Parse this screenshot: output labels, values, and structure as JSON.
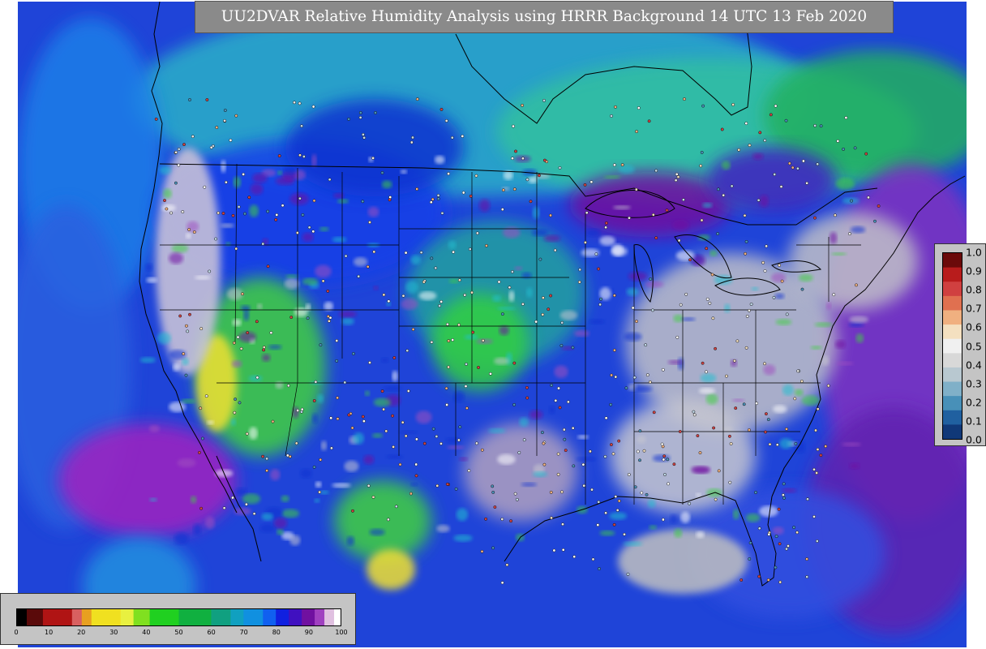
{
  "title": "UU2DVAR Relative Humidity Analysis using HRRR Background 14 UTC 13 Feb 2020",
  "rh_legend": {
    "ticks": [
      "0",
      "10",
      "20",
      "30",
      "40",
      "50",
      "60",
      "70",
      "80",
      "90",
      "100"
    ],
    "min": 0,
    "max": 100,
    "colors": [
      {
        "from": 0,
        "to": 3,
        "color": "#000000"
      },
      {
        "from": 3,
        "to": 8,
        "color": "#5a0a0a"
      },
      {
        "from": 8,
        "to": 17,
        "color": "#b01414"
      },
      {
        "from": 17,
        "to": 20,
        "color": "#d86060"
      },
      {
        "from": 20,
        "to": 23,
        "color": "#e8a020"
      },
      {
        "from": 23,
        "to": 32,
        "color": "#f0e020"
      },
      {
        "from": 32,
        "to": 36,
        "color": "#e8f040"
      },
      {
        "from": 36,
        "to": 41,
        "color": "#80e020"
      },
      {
        "from": 41,
        "to": 50,
        "color": "#20d020"
      },
      {
        "from": 50,
        "to": 60,
        "color": "#10b040"
      },
      {
        "from": 60,
        "to": 66,
        "color": "#10a080"
      },
      {
        "from": 66,
        "to": 70,
        "color": "#10a0c0"
      },
      {
        "from": 70,
        "to": 76,
        "color": "#1090e0"
      },
      {
        "from": 76,
        "to": 80,
        "color": "#1060f0"
      },
      {
        "from": 80,
        "to": 84,
        "color": "#1020e0"
      },
      {
        "from": 84,
        "to": 88,
        "color": "#4010c0"
      },
      {
        "from": 88,
        "to": 92,
        "color": "#7010a0"
      },
      {
        "from": 92,
        "to": 95,
        "color": "#a040c0"
      },
      {
        "from": 95,
        "to": 98,
        "color": "#e0c0e0"
      },
      {
        "from": 98,
        "to": 100,
        "color": "#ffffff"
      }
    ]
  },
  "increment_legend": {
    "ticks": [
      "1.0",
      "0.9",
      "0.8",
      "0.7",
      "0.6",
      "0.5",
      "0.4",
      "0.3",
      "0.2",
      "0.1",
      "0.0"
    ],
    "colors": [
      "#6b0a0a",
      "#b81c1c",
      "#d04040",
      "#e07050",
      "#f0b080",
      "#f4e0c0",
      "#f0f0f0",
      "#d8d8d8",
      "#b8c8d0",
      "#80b0c8",
      "#4890b8",
      "#2060a0",
      "#103878"
    ]
  }
}
